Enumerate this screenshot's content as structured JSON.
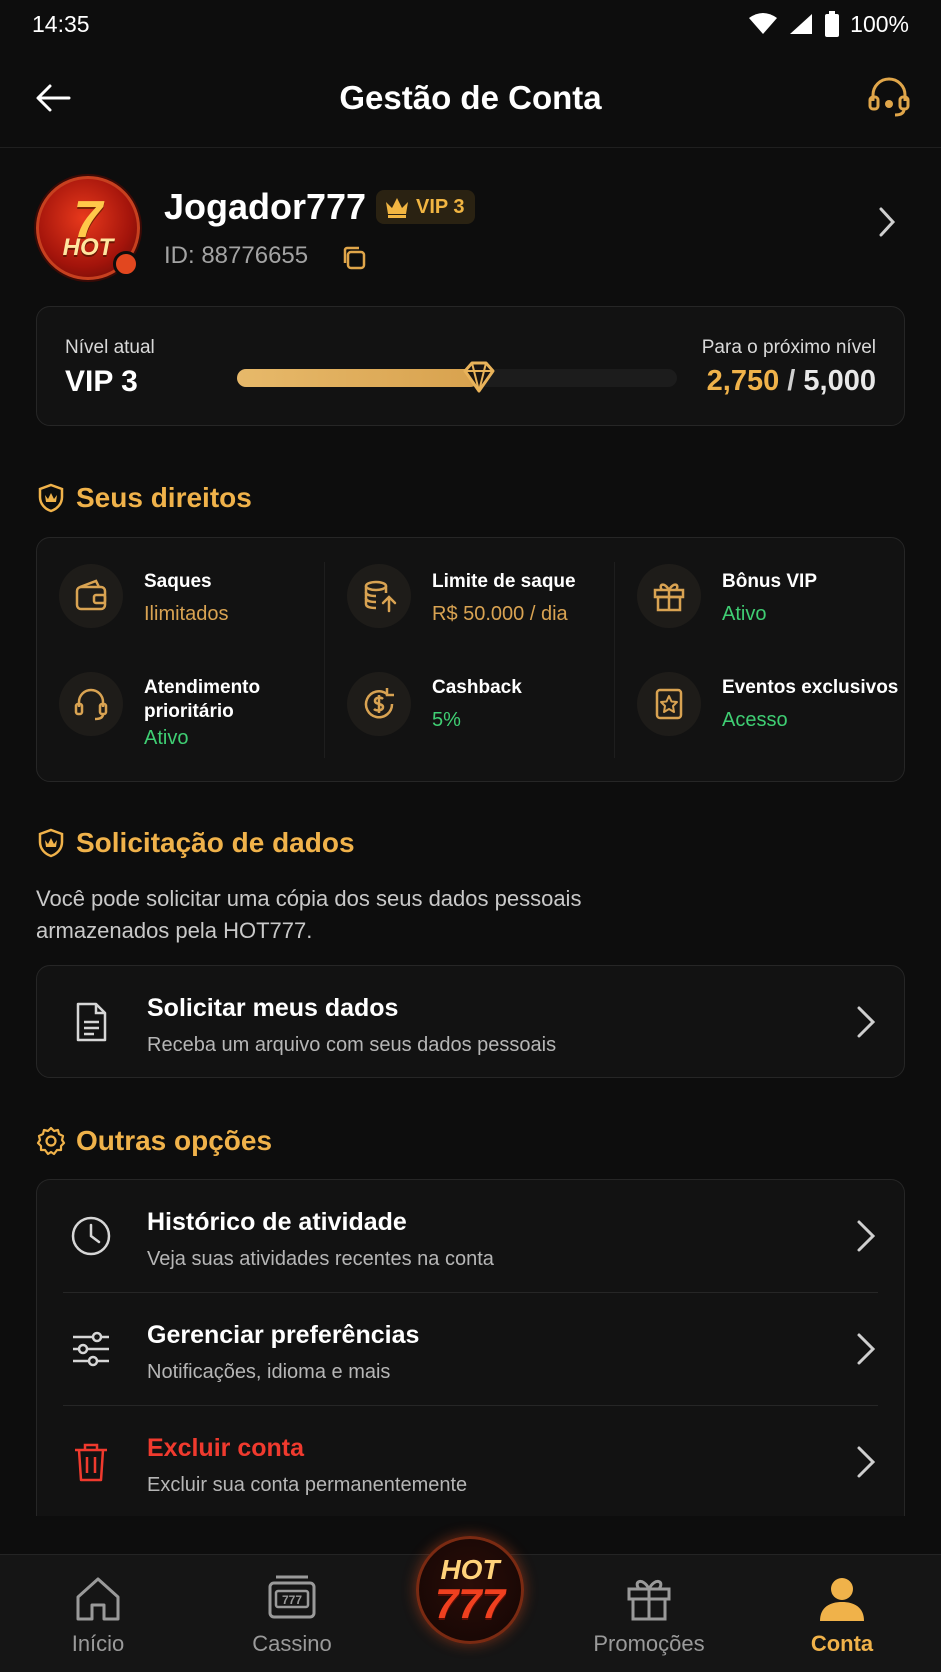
{
  "status_bar": {
    "time": "14:35",
    "battery": "100%"
  },
  "header": {
    "title": "Gestão de Conta"
  },
  "profile": {
    "avatar": {
      "seven": "7",
      "hot": "HOT"
    },
    "username": "Jogador777",
    "vip_badge": "VIP 3",
    "id_text": "ID: 88776655"
  },
  "level": {
    "current_label": "Nível atual",
    "current_value": "VIP 3",
    "next_label": "Para o próximo nível",
    "next_current": "2,750",
    "next_sep": " / ",
    "next_total": "5,000",
    "progress_fraction": 0.55
  },
  "rights": {
    "title": "Seus direitos",
    "items": [
      {
        "name": "Saques",
        "value": "Ilimitados",
        "value_color": "gold",
        "icon": "wallet-icon"
      },
      {
        "name": "Limite de saque",
        "value": "R$ 50.000 / dia",
        "value_color": "gold",
        "icon": "coins-up-icon"
      },
      {
        "name": "Bônus VIP",
        "value": "Ativo",
        "value_color": "green",
        "icon": "gift-icon"
      },
      {
        "name": "Atendimento prioritário",
        "name_line1": "Atendimento",
        "name_line2": "prioritário",
        "value": "Ativo",
        "value_color": "green",
        "icon": "headset-icon"
      },
      {
        "name": "Cashback",
        "value": "5%",
        "value_color": "green",
        "icon": "cashback-icon"
      },
      {
        "name": "Eventos exclusivos",
        "value": "Acesso",
        "value_color": "green",
        "icon": "star-ticket-icon"
      }
    ]
  },
  "data_request": {
    "title": "Solicitação de dados",
    "description_line1": "Você pode solicitar uma cópia dos seus dados pessoais",
    "description_line2": "armazenados pela HOT777.",
    "item": {
      "title": "Solicitar meus dados",
      "subtitle": "Receba um arquivo com seus dados pessoais"
    }
  },
  "other_options": {
    "title": "Outras opções",
    "items": [
      {
        "title": "Histórico de atividade",
        "subtitle": "Veja suas atividades recentes na conta"
      },
      {
        "title": "Gerenciar preferências",
        "subtitle": "Notificações, idioma e mais"
      },
      {
        "title": "Excluir conta",
        "subtitle": "Excluir sua conta permanentemente"
      }
    ]
  },
  "bottom_nav": {
    "items": [
      {
        "label": "Início"
      },
      {
        "label": "Cassino"
      },
      {
        "label": "Promoções"
      },
      {
        "label": "Conta"
      }
    ],
    "center_logo": {
      "top": "HOT",
      "bottom": "777"
    },
    "active": "Conta"
  },
  "colors": {
    "accent": "#f0b24a",
    "green": "#3fce73",
    "danger": "#f03a2e",
    "background": "#0d0d0d"
  }
}
